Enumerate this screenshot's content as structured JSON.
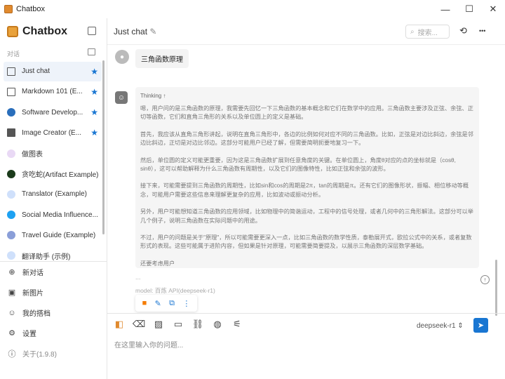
{
  "window": {
    "title": "Chatbox",
    "minimize": "—",
    "maximize": "☐",
    "close": "✕"
  },
  "sidebar": {
    "brand": "Chatbox",
    "section_label": "对话",
    "items": [
      {
        "label": "Just chat",
        "starred": true,
        "icon": "chat-icon"
      },
      {
        "label": "Markdown 101 (E...",
        "starred": true,
        "icon": "chat-icon"
      },
      {
        "label": "Software Develop...",
        "starred": true,
        "icon": "developer-avatar-icon"
      },
      {
        "label": "Image Creator (E...",
        "starred": true,
        "icon": "image-icon"
      },
      {
        "label": "做图表",
        "starred": false,
        "icon": "chart-avatar-icon"
      },
      {
        "label": "贪吃蛇(Artifact Example)",
        "starred": false,
        "icon": "snake-avatar-icon"
      },
      {
        "label": "Translator (Example)",
        "starred": false,
        "icon": "translate-avatar-icon"
      },
      {
        "label": "Social Media Influence...",
        "starred": false,
        "icon": "twitter-icon"
      },
      {
        "label": "Travel Guide (Example)",
        "starred": false,
        "icon": "globe-avatar-icon"
      },
      {
        "label": "翻译助手 (示例)",
        "starred": false,
        "icon": "translate-avatar-icon"
      }
    ],
    "bottom": [
      {
        "label": "新对话",
        "icon": "⊕"
      },
      {
        "label": "新图片",
        "icon": "▣"
      },
      {
        "label": "我的搭档",
        "icon": "☺"
      },
      {
        "label": "设置",
        "icon": "⚙"
      },
      {
        "label": "关于(1.9.8)",
        "icon": "ⓘ"
      }
    ],
    "star": "★"
  },
  "header": {
    "title": "Just chat",
    "edit_icon": "✎",
    "search_placeholder": "搜索...",
    "history_icon": "⟲",
    "more_icon": "•••"
  },
  "chat": {
    "user_message": "三角函数原理",
    "thinking_label": "Thinking ↑",
    "paragraphs": [
      "嗯，用户问的是三角函数的原理，我需要先回忆一下三角函数的基本概念和它们在数学中的应用。三角函数主要涉及正弦、余弦、正切等函数，它们和直角三角形的关系以及单位圆上的定义是基础。",
      "首先，我应该从直角三角形讲起，说明在直角三角形中，各边的比例如何对应不同的三角函数。比如，正弦是对边比斜边，余弦是邻边比斜边，正切是对边比邻边。这部分可能用户已经了解，但需要简明扼要地复习一下。",
      "然后，单位圆的定义可能更重要，因为这是三角函数扩展到任意角度的关键。在单位圆上，角度θ对应的点的坐标就是（cosθ, sinθ），这可以帮助解释为什么三角函数有周期性，以及它们的图像特性，比如正弦和余弦的波形。",
      "接下来，可能需要提到三角函数的周期性，比如sin和cos的周期是2π，tan的周期是π。还有它们的图像形状，振幅、相位移动等概念，可能用户需要这些信息来理解更复杂的应用，比如波动或振动分析。",
      "另外，用户可能想知道三角函数的应用领域，比如物理中的简谐运动，工程中的信号处理，或者几何中的三角形解法。这部分可以举几个例子，说明三角函数在实际问题中的用途。",
      "不过，用户的问题是关于\"原理\"，所以可能需要更深入一点，比如三角函数的数学性质，泰勒展开式，欧拉公式中的关系，或者复数形式的表现。这些可能属于进阶内容，但如果是针对原理，可能需要简要提及，以展示三角函数的深层数学基础。",
      "还要考虑用户"
    ],
    "ellipsis": "...",
    "model_info": "model: 百炼 API(deepseek-r1)",
    "actions": {
      "stop": "■",
      "edit": "✎",
      "copy": "⧉",
      "more": "⋮"
    }
  },
  "input": {
    "placeholder": "在这里输入你的问题...",
    "model": "deepseek-r1 ⇕",
    "send_icon": "➤",
    "tools": [
      "◧",
      "⌫",
      "▨",
      "▭",
      "⛓",
      "◍",
      "⚟"
    ]
  },
  "colors": {
    "accent": "#1976d2",
    "stop": "#f57c00"
  }
}
